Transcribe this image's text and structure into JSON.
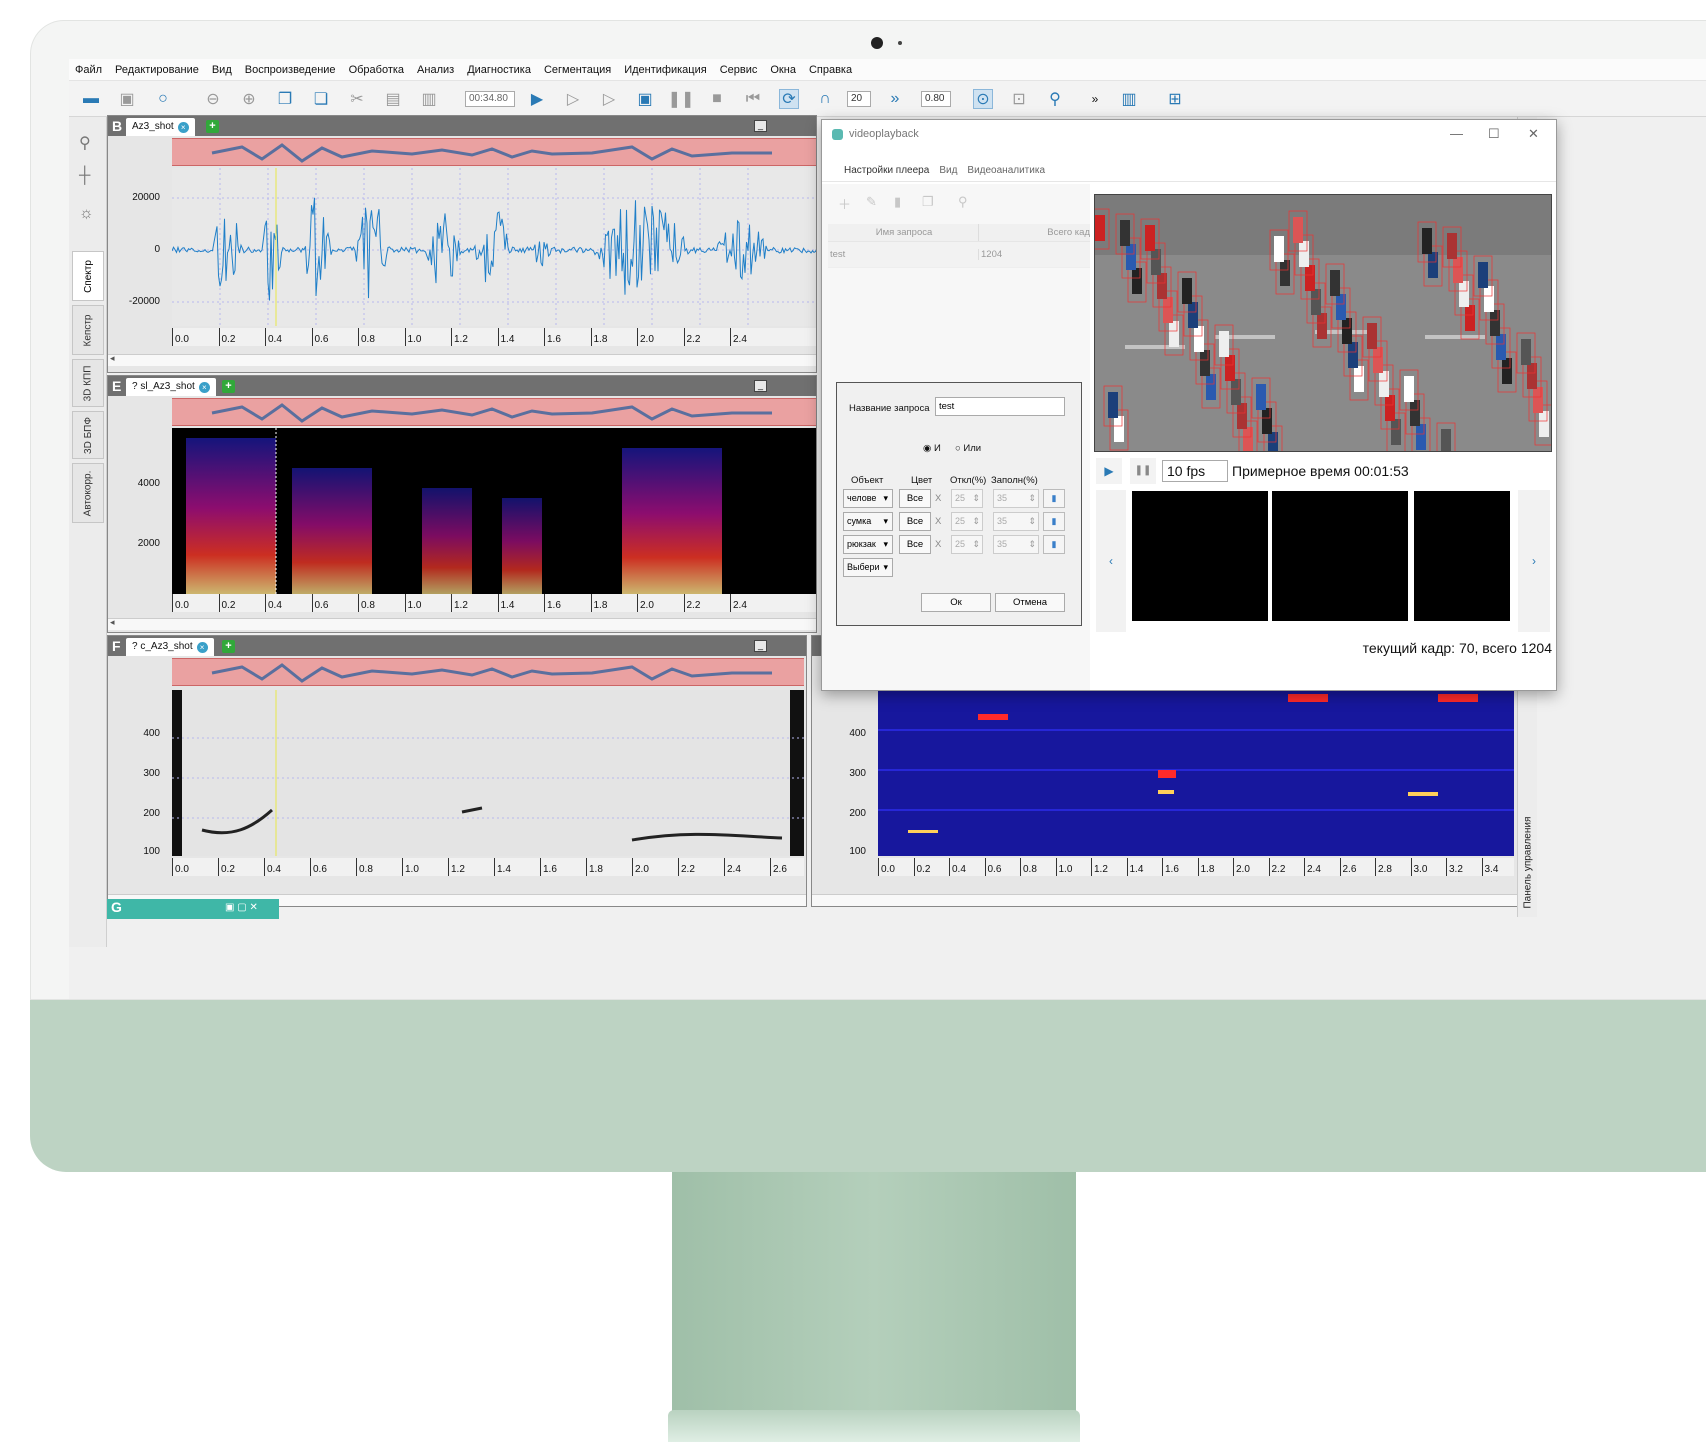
{
  "menu": [
    "Файл",
    "Редактирование",
    "Вид",
    "Воспроизведение",
    "Обработка",
    "Анализ",
    "Диагностика",
    "Сегментация",
    "Идентификация",
    "Сервис",
    "Окна",
    "Справка"
  ],
  "toolbar": {
    "time": "00:34.80",
    "speed": "20",
    "rate": "0.80",
    "more": "»"
  },
  "side_tabs": [
    "Спектр",
    "Кепстр",
    "3D КПП",
    "3D БПФ",
    "Автокорр."
  ],
  "right_panel_label": "Панель управления",
  "panes": {
    "b": {
      "letter": "B",
      "tab": "Az3_shot",
      "yticks": [
        "20000",
        "0",
        "-20000"
      ],
      "xticks": [
        "0.0",
        "0.2",
        "0.4",
        "0.6",
        "0.8",
        "1.0",
        "1.2",
        "1.4",
        "1.6",
        "1.8",
        "2.0",
        "2.2",
        "2.4"
      ]
    },
    "e": {
      "letter": "E",
      "tab": "? sl_Az3_shot",
      "yticks": [
        "4000",
        "2000"
      ],
      "xticks": [
        "0.0",
        "0.2",
        "0.4",
        "0.6",
        "0.8",
        "1.0",
        "1.2",
        "1.4",
        "1.6",
        "1.8",
        "2.0",
        "2.2",
        "2.4"
      ]
    },
    "f": {
      "letter": "F",
      "tab": "? c_Az3_shot",
      "yticks": [
        "400",
        "300",
        "200",
        "100"
      ],
      "xticks": [
        "0.0",
        "0.2",
        "0.4",
        "0.6",
        "0.8",
        "1.0",
        "1.2",
        "1.4",
        "1.6",
        "1.8",
        "2.0",
        "2.2",
        "2.4",
        "2.6"
      ]
    },
    "r": {
      "yticks": [
        "400",
        "300",
        "200",
        "100"
      ],
      "xticks": [
        "0.0",
        "0.2",
        "0.4",
        "0.6",
        "0.8",
        "1.0",
        "1.2",
        "1.4",
        "1.6",
        "1.8",
        "2.0",
        "2.2",
        "2.4",
        "2.6",
        "2.8",
        "3.0",
        "3.2",
        "3.4"
      ]
    },
    "g": {
      "letter": "G"
    }
  },
  "video": {
    "title": "videoplayback",
    "menu": [
      "Настройки плеера",
      "Вид",
      "Видеоаналитика"
    ],
    "table": {
      "col1": "Имя запроса",
      "col2": "Всего кад",
      "row": {
        "name": "test",
        "total": "1204"
      }
    },
    "dialog": {
      "name_label": "Название запроса",
      "name_value": "test",
      "and_label": "И",
      "or_label": "Или",
      "col_object": "Объект",
      "col_color": "Цвет",
      "col_dev": "Откл(%)",
      "col_fill": "Заполн(%)",
      "rows": [
        {
          "object": "челове",
          "color": "Все",
          "x": "X",
          "dev": "25",
          "fill": "35"
        },
        {
          "object": "сумка",
          "color": "Все",
          "x": "X",
          "dev": "25",
          "fill": "35"
        },
        {
          "object": "рюкзак",
          "color": "Все",
          "x": "X",
          "dev": "25",
          "fill": "35"
        }
      ],
      "select_placeholder": "Выбери",
      "ok": "Ок",
      "cancel": "Отмена"
    },
    "fps": "10 fps",
    "approx_time": "Примерное время 00:01:53",
    "frame_info": "текущий кадр: 70, всего 1204"
  },
  "colors": {
    "accent": "#2a7ab5",
    "overview": "#eaa1a1",
    "monitor_chin": "#bdd3c3",
    "teal_bar": "#3fb7a7"
  }
}
